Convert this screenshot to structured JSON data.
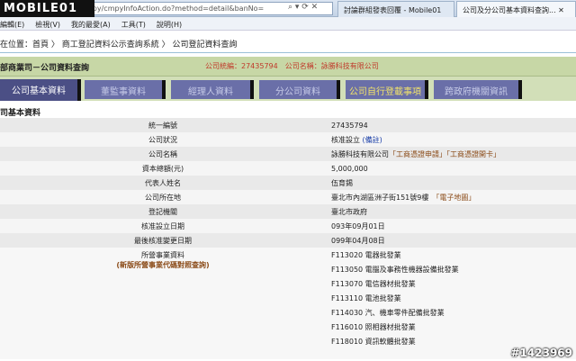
{
  "browser": {
    "logo": "MOBILE01",
    "address": "mpy/cmpyInfoAction.do?method=detail&banNo=",
    "tabs": [
      "討論群組發表回覆 - Mobile01",
      "公司及分公司基本資料查詢..."
    ]
  },
  "menu": [
    "編輯(E)",
    "檢視(V)",
    "我的最愛(A)",
    "工具(T)",
    "說明(H)"
  ],
  "breadcrumb": "在位置：首頁 〉 商工登記資料公示查詢系統 〉 公司登記資料查詢",
  "header": {
    "title": "部商業司－公司資料查詢",
    "info": "公司統編：27435794　公司名稱：詠勝科技有限公司"
  },
  "tabs": [
    "公司基本資料",
    "董監事資料",
    "經理人資料",
    "分公司資料",
    "公司自行登載事項",
    "跨政府機關資訊"
  ],
  "section_title": "司基本資料",
  "rows": [
    {
      "label": "統一編號",
      "value": "27435794"
    },
    {
      "label": "公司狀況",
      "value": "核准設立",
      "link": "(備註)"
    },
    {
      "label": "公司名稱",
      "value": "詠勝科技有限公司",
      "link": "「工商憑證申請」「工商憑證開卡」"
    },
    {
      "label": "資本總額(元)",
      "value": "5,000,000"
    },
    {
      "label": "代表人姓名",
      "value": "伍育錫"
    },
    {
      "label": "公司所在地",
      "value": "臺北市內湖區洲子街151號9樓",
      "link": "「電子地圖」"
    },
    {
      "label": "登記機關",
      "value": "臺北市政府"
    },
    {
      "label": "核准設立日期",
      "value": "093年09月01日"
    },
    {
      "label": "最後核准變更日期",
      "value": "099年04月08日"
    }
  ],
  "business": {
    "label": "所營事業資料",
    "sublink": "(新版所營事業代碼對照查詢)",
    "items": [
      "F113020 電器批發業",
      "F113050 電腦及事務性機器設備批發業",
      "F113070 電信器材批發業",
      "F113110 電池批發業",
      "F114030 汽、機車零件配備批發業",
      "F116010 照相器材批發業",
      "F118010 資訊軟體批發業"
    ]
  },
  "watermark": "#1423969"
}
